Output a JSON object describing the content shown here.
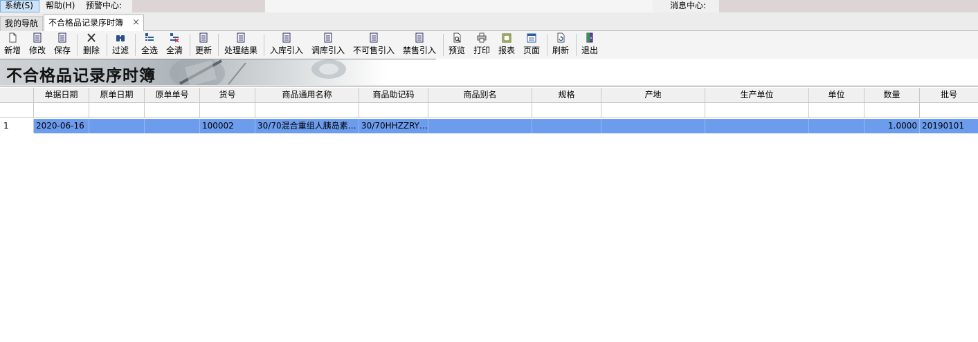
{
  "menu": {
    "system": "系统(S)",
    "help": "帮助(H)",
    "alert_center": "预警中心:",
    "message_center": "消息中心:"
  },
  "tabs": {
    "nav": "我的导航",
    "current": "不合格品记录序时簿",
    "close_icon": "×"
  },
  "toolbar": {
    "new": "新增",
    "edit": "修改",
    "save": "保存",
    "delete": "删除",
    "filter": "过滤",
    "select_all": "全选",
    "clear_all": "全清",
    "update": "更新",
    "process_result": "处理结果",
    "inbound_import": "入库引入",
    "transfer_import": "调库引入",
    "unsellable_import": "不可售引入",
    "banned_import": "禁售引入",
    "preview": "预览",
    "print": "打印",
    "report": "报表",
    "page": "页面",
    "refresh": "刷新",
    "exit": "退出"
  },
  "banner": {
    "title": "不合格品记录序时簿"
  },
  "table": {
    "columns": [
      "单据日期",
      "原单日期",
      "原单单号",
      "货号",
      "商品通用名称",
      "商品助记码",
      "商品别名",
      "规格",
      "产地",
      "生产单位",
      "单位",
      "数量",
      "批号"
    ],
    "rows": [
      {
        "row_number": "1",
        "doc_date": "2020-06-16",
        "orig_date": "",
        "orig_no": "",
        "item_no": "100002",
        "generic_name": "30/70混合重组人胰岛素…",
        "mnemonic": "30/70HHZZRY…",
        "alias": "",
        "spec": "",
        "origin": "",
        "manufacturer": "",
        "unit": "",
        "quantity": "1.0000",
        "batch_no": "20190101"
      }
    ]
  },
  "colors": {
    "selected_row": "#6c9ced",
    "header_bg": "#f0f0f0"
  }
}
